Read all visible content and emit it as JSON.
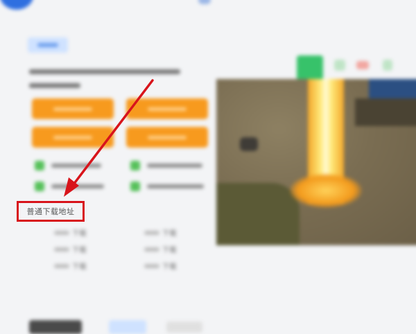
{
  "highlight": {
    "label": "普通下载地址",
    "box_color": "#d8141b",
    "arrow_color": "#d8141b"
  },
  "download_links": [
    {
      "text": "下载",
      "column": 1
    },
    {
      "text": "下载",
      "column": 1
    },
    {
      "text": "下载",
      "column": 1
    },
    {
      "text": "下载",
      "column": 2
    },
    {
      "text": "下载",
      "column": 2
    },
    {
      "text": "下载",
      "column": 2
    }
  ],
  "colors": {
    "accent_orange": "#f79a1e",
    "accent_green": "#56c15a",
    "accent_blue": "#2f6fe0"
  },
  "icons": {
    "red_pointer": "arrow-icon",
    "row_icons": "android-icon"
  }
}
